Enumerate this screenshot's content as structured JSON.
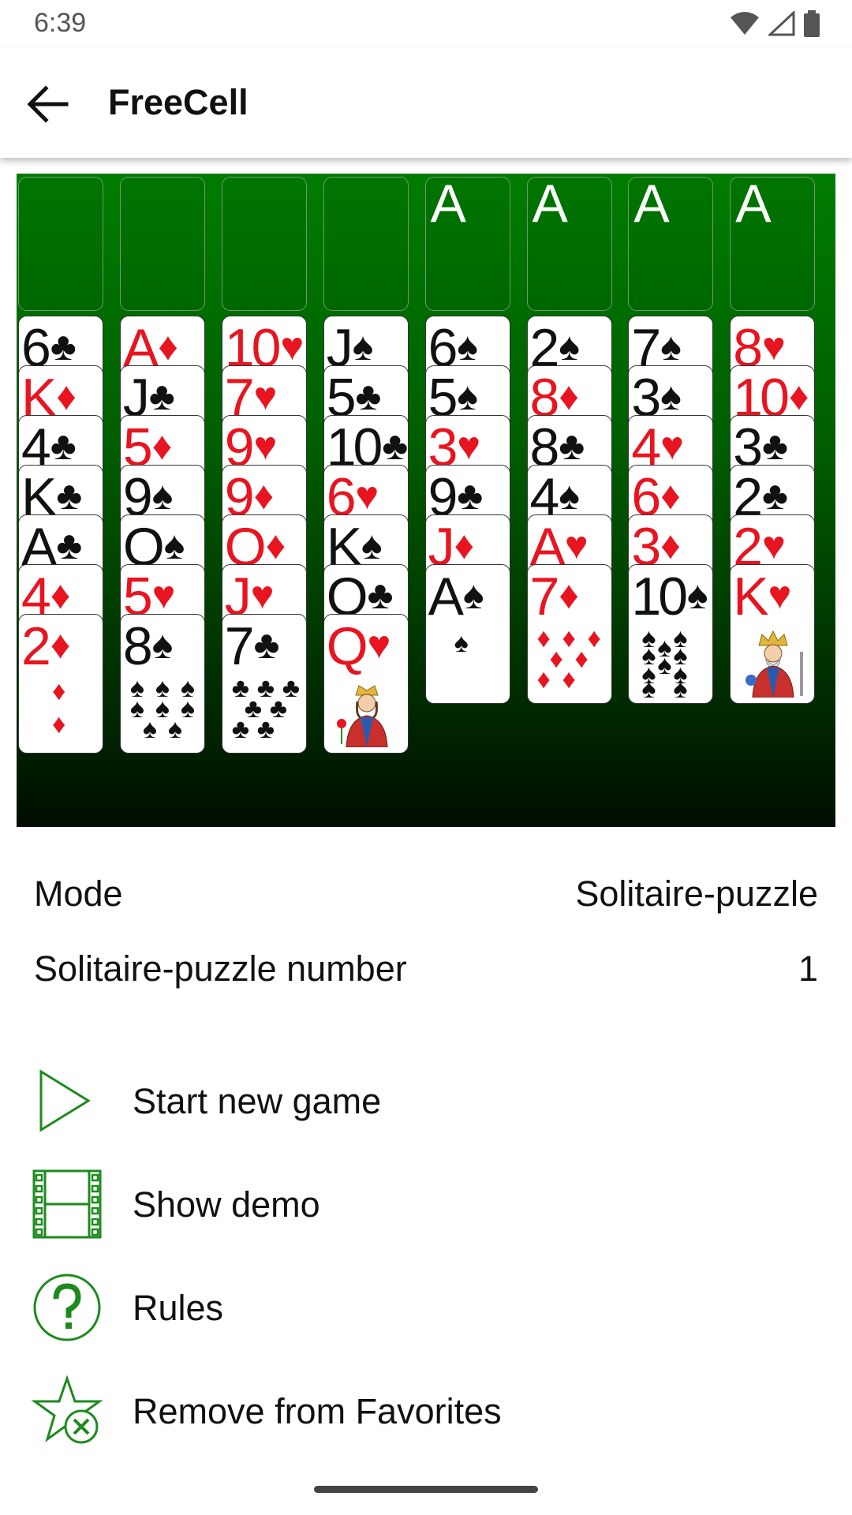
{
  "status_bar": {
    "time": "6:39",
    "icons": [
      "wifi-icon",
      "signal-icon",
      "battery-icon"
    ]
  },
  "app_bar": {
    "title": "FreeCell",
    "back_icon": "arrow-left-icon"
  },
  "board": {
    "foundations": [
      "",
      "",
      "",
      "",
      "A",
      "A",
      "A",
      "A"
    ],
    "columns": [
      [
        {
          "r": "6",
          "s": "♣"
        },
        {
          "r": "K",
          "s": "♦"
        },
        {
          "r": "4",
          "s": "♣"
        },
        {
          "r": "K",
          "s": "♣"
        },
        {
          "r": "A",
          "s": "♣"
        },
        {
          "r": "4",
          "s": "♦"
        },
        {
          "r": "2",
          "s": "♦"
        }
      ],
      [
        {
          "r": "A",
          "s": "♦"
        },
        {
          "r": "J",
          "s": "♣"
        },
        {
          "r": "5",
          "s": "♦"
        },
        {
          "r": "9",
          "s": "♠"
        },
        {
          "r": "Q",
          "s": "♠"
        },
        {
          "r": "5",
          "s": "♥"
        },
        {
          "r": "8",
          "s": "♠"
        }
      ],
      [
        {
          "r": "10",
          "s": "♥"
        },
        {
          "r": "7",
          "s": "♥"
        },
        {
          "r": "9",
          "s": "♥"
        },
        {
          "r": "9",
          "s": "♦"
        },
        {
          "r": "Q",
          "s": "♦"
        },
        {
          "r": "J",
          "s": "♥"
        },
        {
          "r": "7",
          "s": "♣"
        }
      ],
      [
        {
          "r": "J",
          "s": "♠"
        },
        {
          "r": "5",
          "s": "♣"
        },
        {
          "r": "10",
          "s": "♣"
        },
        {
          "r": "6",
          "s": "♥"
        },
        {
          "r": "K",
          "s": "♠"
        },
        {
          "r": "Q",
          "s": "♣"
        },
        {
          "r": "Q",
          "s": "♥"
        }
      ],
      [
        {
          "r": "6",
          "s": "♠"
        },
        {
          "r": "5",
          "s": "♠"
        },
        {
          "r": "3",
          "s": "♥"
        },
        {
          "r": "9",
          "s": "♣"
        },
        {
          "r": "J",
          "s": "♦"
        },
        {
          "r": "A",
          "s": "♠"
        }
      ],
      [
        {
          "r": "2",
          "s": "♠"
        },
        {
          "r": "8",
          "s": "♦"
        },
        {
          "r": "8",
          "s": "♣"
        },
        {
          "r": "4",
          "s": "♠"
        },
        {
          "r": "A",
          "s": "♥"
        },
        {
          "r": "7",
          "s": "♦"
        }
      ],
      [
        {
          "r": "7",
          "s": "♠"
        },
        {
          "r": "3",
          "s": "♠"
        },
        {
          "r": "4",
          "s": "♥"
        },
        {
          "r": "6",
          "s": "♦"
        },
        {
          "r": "3",
          "s": "♦"
        },
        {
          "r": "10",
          "s": "♠"
        }
      ],
      [
        {
          "r": "8",
          "s": "♥"
        },
        {
          "r": "10",
          "s": "♦"
        },
        {
          "r": "3",
          "s": "♣"
        },
        {
          "r": "2",
          "s": "♣"
        },
        {
          "r": "2",
          "s": "♥"
        },
        {
          "r": "K",
          "s": "♥"
        }
      ]
    ]
  },
  "info": {
    "mode_label": "Mode",
    "mode_value": "Solitaire-puzzle",
    "number_label": "Solitaire-puzzle number",
    "number_value": "1"
  },
  "menu": [
    {
      "label": "Start new game",
      "icon": "play-icon"
    },
    {
      "label": "Show demo",
      "icon": "film-icon"
    },
    {
      "label": "Rules",
      "icon": "help-icon"
    },
    {
      "label": "Remove from Favorites",
      "icon": "star-remove-icon"
    }
  ],
  "colors": {
    "accent": "#1e8a1e",
    "board_top": "#007c00",
    "board_bottom": "#000d00",
    "red_suit": "#e8141f"
  }
}
